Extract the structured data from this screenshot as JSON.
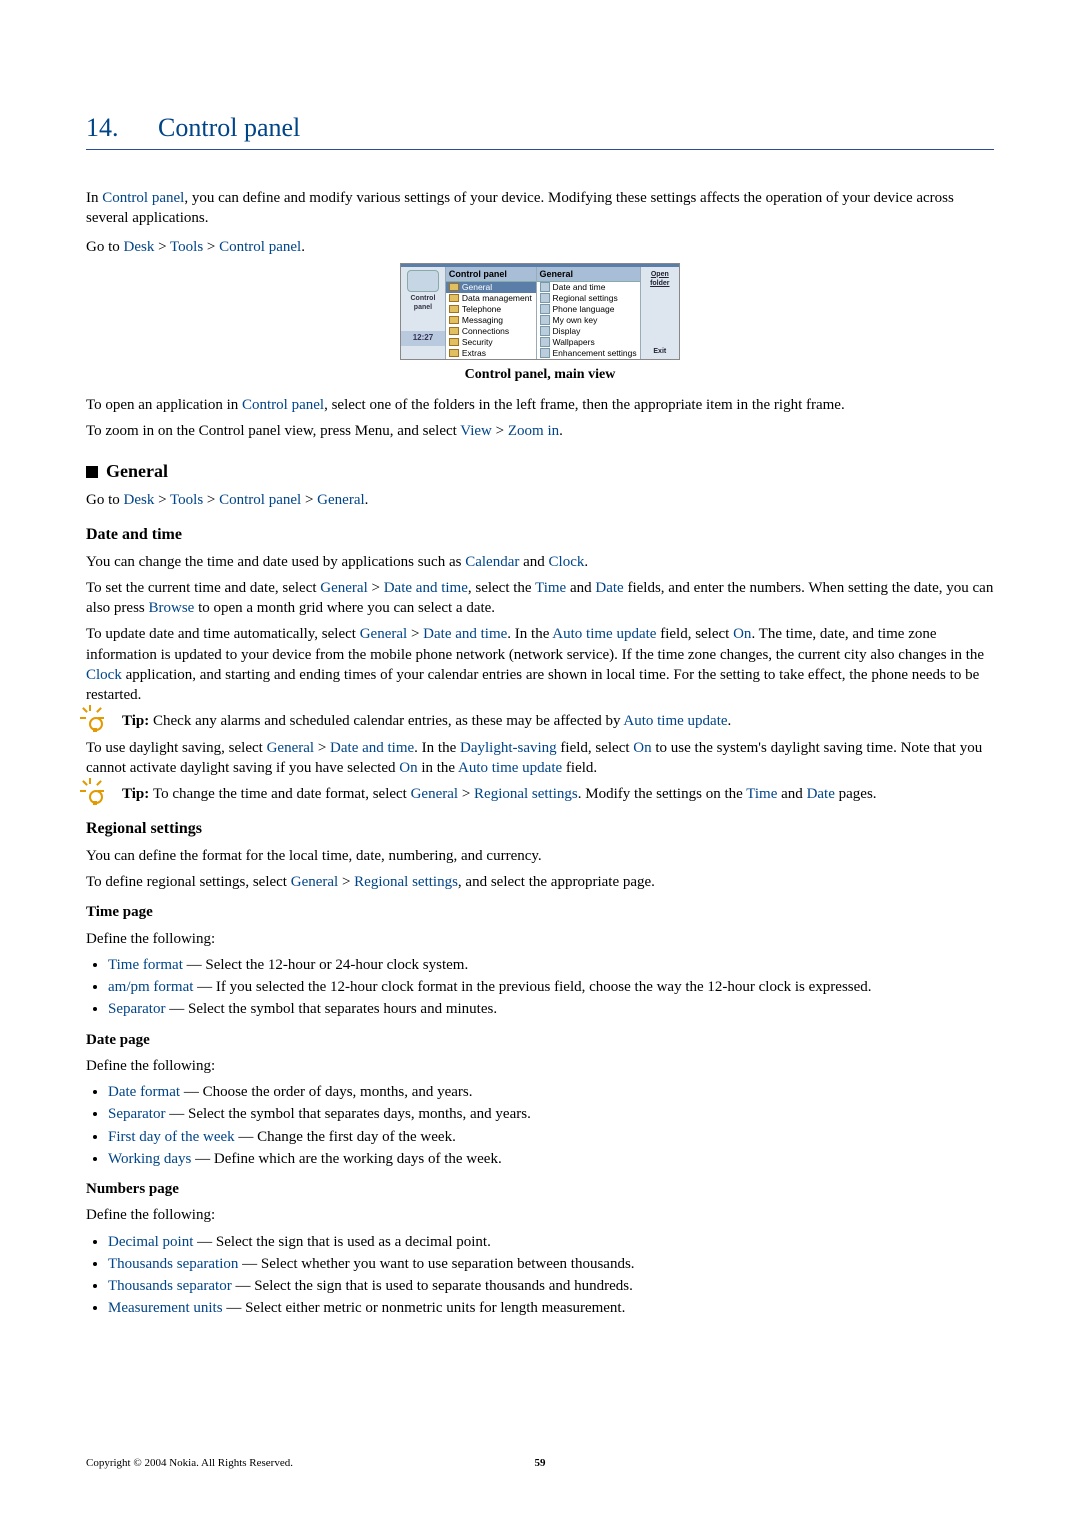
{
  "chapter": {
    "num": "14.",
    "title": "Control panel"
  },
  "intro": {
    "p1a": "In ",
    "p1b": "Control panel",
    "p1c": ", you can define and modify various settings of your device. Modifying these settings affects the operation of your device across several applications.",
    "nav_prefix": "Go to ",
    "nav_desk": "Desk",
    "nav_tools": "Tools",
    "nav_cp": "Control panel"
  },
  "shot": {
    "left_label": "Control panel",
    "left_time": "12:27",
    "mid_title": "Control panel",
    "mid_items": [
      "General",
      "Data management",
      "Telephone",
      "Messaging",
      "Connections",
      "Security",
      "Extras"
    ],
    "right_title": "General",
    "right_items": [
      "Date and time",
      "Regional settings",
      "Phone language",
      "My own key",
      "Display",
      "Wallpapers",
      "Enhancement settings"
    ],
    "act_open": "Open folder",
    "act_exit": "Exit",
    "caption": "Control panel, main view"
  },
  "after_shot": {
    "p1a": "To open an application in ",
    "p1b": "Control panel",
    "p1c": ", select one of the folders in the left frame, then the appropriate item in the right frame.",
    "p2a": "To zoom in on the Control panel view, press Menu, and select ",
    "p2b": "View",
    "p2gt": " > ",
    "p2c": "Zoom in",
    "p2d": "."
  },
  "general": {
    "heading": "General",
    "nav_prefix": "Go to ",
    "nav_desk": "Desk",
    "nav_tools": "Tools",
    "nav_cp": "Control panel",
    "nav_gen": "General"
  },
  "dt": {
    "heading": "Date and time",
    "p1a": "You can change the time and date used by applications such as ",
    "p1b": "Calendar",
    "p1c": " and ",
    "p1d": "Clock",
    "p1e": ".",
    "p2a": "To set the current time and date, select ",
    "p2b": "General",
    "p2gt": " > ",
    "p2c": "Date and time",
    "p2d": ", select the ",
    "p2e": "Time",
    "p2f": " and ",
    "p2g": "Date",
    "p2h": " fields, and enter the numbers. When setting the date, you can also press ",
    "p2i": "Browse",
    "p2j": " to open a month grid where you can select a date.",
    "p3a": "To update date and time automatically, select ",
    "p3b": "General",
    "p3c": "Date and time",
    "p3d": ". In the ",
    "p3e": "Auto time update",
    "p3f": " field, select ",
    "p3g": "On",
    "p3h": ". The time, date, and time zone information is updated to your device from the mobile phone network (network service). If the time zone changes, the current city also changes in the ",
    "p3i": "Clock",
    "p3j": " application, and starting and ending times of your calendar entries are shown in local time. For the setting to take effect, the phone needs to be restarted.",
    "tip1_label": "Tip: ",
    "tip1a": "Check any alarms and scheduled calendar entries, as these may be affected by ",
    "tip1b": "Auto time update",
    "tip1c": ".",
    "p4a": "To use daylight saving, select ",
    "p4b": "General",
    "p4c": "Date and time",
    "p4d": ". In the ",
    "p4e": "Daylight-saving",
    "p4f": " field, select ",
    "p4g": "On",
    "p4h": " to use the system's daylight saving time. Note that you cannot activate daylight saving if you have selected ",
    "p4i": "On",
    "p4j": " in the ",
    "p4k": "Auto time update",
    "p4l": " field.",
    "tip2_label": "Tip: ",
    "tip2a": "To change the time and date format, select ",
    "tip2b": "General",
    "tip2c": "Regional settings",
    "tip2d": ". Modify the settings on the ",
    "tip2e": "Time",
    "tip2f": " and ",
    "tip2g": "Date",
    "tip2h": " pages."
  },
  "rs": {
    "heading": "Regional settings",
    "p1": "You can define the format for the local time, date, numbering, and currency.",
    "p2a": "To define regional settings, select ",
    "p2b": "General",
    "p2gt": " > ",
    "p2c": "Regional settings",
    "p2d": ", and select the appropriate page."
  },
  "pages": {
    "time_h": "Time page",
    "define": "Define the following:",
    "time_items": [
      {
        "t": "Time format",
        "d": " — Select the 12-hour or 24-hour clock system."
      },
      {
        "t": "am/pm format",
        "d": " — If you selected the 12-hour clock format in the previous field, choose the way the 12-hour clock is expressed."
      },
      {
        "t": "Separator",
        "d": " — Select the symbol that separates hours and minutes."
      }
    ],
    "date_h": "Date page",
    "date_items": [
      {
        "t": "Date format",
        "d": " — Choose the order of days, months, and years."
      },
      {
        "t": "Separator",
        "d": " — Select the symbol that separates days, months, and years."
      },
      {
        "t": "First day of the week",
        "d": " — Change the first day of the week."
      },
      {
        "t": "Working days",
        "d": " — Define which are the working days of the week."
      }
    ],
    "num_h": "Numbers page",
    "num_items": [
      {
        "t": "Decimal point",
        "d": " — Select the sign that is used as a decimal point."
      },
      {
        "t": "Thousands separation",
        "d": " — Select whether you want to use separation between thousands."
      },
      {
        "t": "Thousands separator",
        "d": " — Select the sign that is used to separate thousands and hundreds."
      },
      {
        "t": "Measurement units",
        "d": " — Select either metric or nonmetric units for length measurement."
      }
    ]
  },
  "footer": {
    "copyright": "Copyright © 2004 Nokia. All Rights Reserved.",
    "page": "59"
  },
  "sym": {
    "gt": " > ",
    "dot": "."
  }
}
